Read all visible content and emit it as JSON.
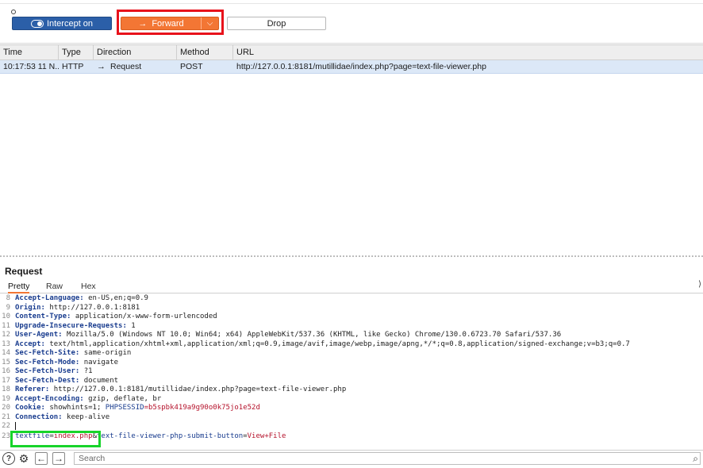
{
  "toolbar": {
    "intercept_label": "Intercept on",
    "forward_label": "Forward",
    "forward_icon": "arrow-right-icon",
    "forward_menu_icon": "chevron-down-icon",
    "drop_label": "Drop"
  },
  "history": {
    "columns": [
      "Time",
      "Type",
      "Direction",
      "Method",
      "URL"
    ],
    "rows": [
      {
        "time": "10:17:53 11 N...",
        "type": "HTTP",
        "direction_icon": "arrow-right-icon",
        "direction": "Request",
        "method": "POST",
        "url": "http://127.0.0.1:8181/mutillidae/index.php?page=text-file-viewer.php"
      }
    ]
  },
  "request": {
    "title": "Request",
    "tabs": [
      "Pretty",
      "Raw",
      "Hex"
    ],
    "active_tab": "Pretty",
    "lines": [
      {
        "n": "8",
        "key": "Accept-Language:",
        "val": " en-US,en;q=0.9"
      },
      {
        "n": "9",
        "key": "Origin:",
        "val": " http://127.0.0.1:8181"
      },
      {
        "n": "10",
        "key": "Content-Type:",
        "val": " application/x-www-form-urlencoded"
      },
      {
        "n": "11",
        "key": "Upgrade-Insecure-Requests:",
        "val": " 1"
      },
      {
        "n": "12",
        "key": "User-Agent:",
        "val": " Mozilla/5.0 (Windows NT 10.0; Win64; x64) AppleWebKit/537.36 (KHTML, like Gecko) Chrome/130.0.6723.70 Safari/537.36"
      },
      {
        "n": "13",
        "key": "Accept:",
        "val": " text/html,application/xhtml+xml,application/xml;q=0.9,image/avif,image/webp,image/apng,*/*;q=0.8,application/signed-exchange;v=b3;q=0.7"
      },
      {
        "n": "14",
        "key": "Sec-Fetch-Site:",
        "val": " same-origin"
      },
      {
        "n": "15",
        "key": "Sec-Fetch-Mode:",
        "val": " navigate"
      },
      {
        "n": "16",
        "key": "Sec-Fetch-User:",
        "val": " ?1"
      },
      {
        "n": "17",
        "key": "Sec-Fetch-Dest:",
        "val": " document"
      },
      {
        "n": "18",
        "key": "Referer:",
        "val": " http://127.0.0.1:8181/mutillidae/index.php?page=text-file-viewer.php"
      },
      {
        "n": "19",
        "key": "Accept-Encoding:",
        "val": " gzip, deflate, br"
      },
      {
        "n": "20",
        "key": "Cookie:",
        "val": " showhints=1; ",
        "cookie_name": "PHPSESSID",
        "cookie_val": "=b5spbk419a9g90o0k75jo1e52d"
      },
      {
        "n": "21",
        "key": "Connection:",
        "val": " keep-alive"
      }
    ],
    "line22_n": "22",
    "body_line": {
      "n": "23",
      "p1_name": "textfile",
      "p1_eq": "=",
      "p1_val": "index.php",
      "amp1": "&",
      "p2_name": "text-file-viewer-php-submit-button",
      "p2_eq": "=",
      "p2_val": "View+File"
    }
  },
  "bottom": {
    "search_placeholder": "Search",
    "help_icon": "help-icon",
    "settings_icon": "gear-icon",
    "back_icon": "arrow-left-icon",
    "forward_icon": "arrow-right-icon",
    "search_icon": "search-icon"
  },
  "colors": {
    "forward_button": "#f37634",
    "intercept_button": "#2b5fa8",
    "highlight_red": "#e8121b",
    "highlight_green": "#17d42a",
    "selected_row": "#dce8f7"
  }
}
